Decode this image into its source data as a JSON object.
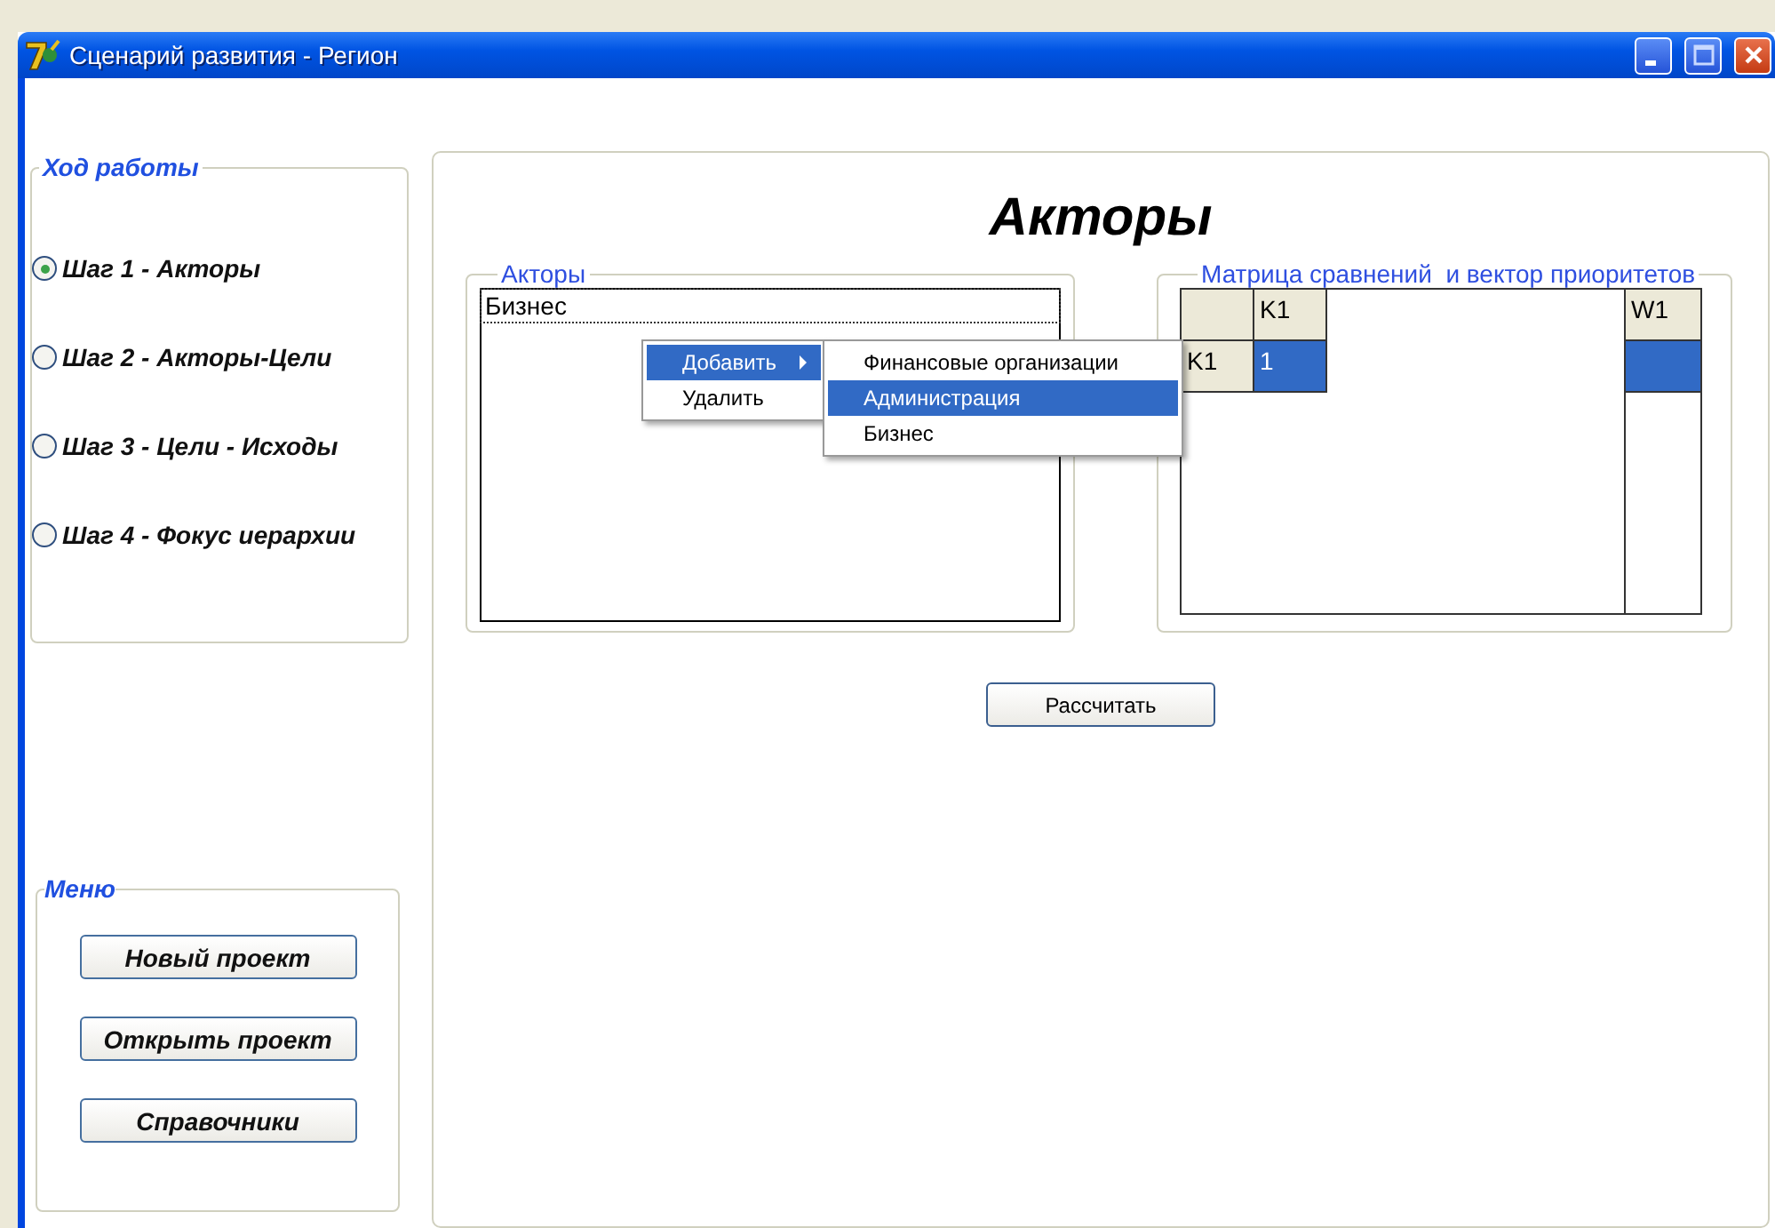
{
  "window": {
    "title": "Сценарий развития - Регион"
  },
  "progress": {
    "title": "Ход работы",
    "steps": [
      {
        "label": "Шаг 1 - Акторы",
        "selected": true
      },
      {
        "label": "Шаг 2 - Акторы-Цели",
        "selected": false
      },
      {
        "label": "Шаг 3 - Цели - Исходы",
        "selected": false
      },
      {
        "label": "Шаг 4 - Фокус иерархии",
        "selected": false
      }
    ]
  },
  "menu": {
    "title": "Меню",
    "buttons": [
      "Новый проект",
      "Открыть проект",
      "Справочники"
    ]
  },
  "page_title": "Акторы",
  "actors": {
    "title": "Акторы",
    "items": [
      {
        "label": "Бизнес",
        "focused": true
      }
    ]
  },
  "matrix": {
    "title": "Матрица сравнений  и вектор приоритетов",
    "columns": [
      "K1"
    ],
    "weight_header": "W1",
    "rows": [
      {
        "header": "K1",
        "cells": [
          {
            "value": "1",
            "selected": true
          }
        ],
        "weight_selected": true
      }
    ]
  },
  "context_menu": {
    "items": [
      {
        "label": "Добавить",
        "has_submenu": true,
        "highlighted": true
      },
      {
        "label": "Удалить",
        "has_submenu": false,
        "highlighted": false
      }
    ],
    "submenu": [
      {
        "label": "Финансовые организации",
        "highlighted": false
      },
      {
        "label": "Администрация",
        "highlighted": true
      },
      {
        "label": "Бизнес",
        "highlighted": false
      }
    ]
  },
  "calculate_button": "Рассчитать"
}
